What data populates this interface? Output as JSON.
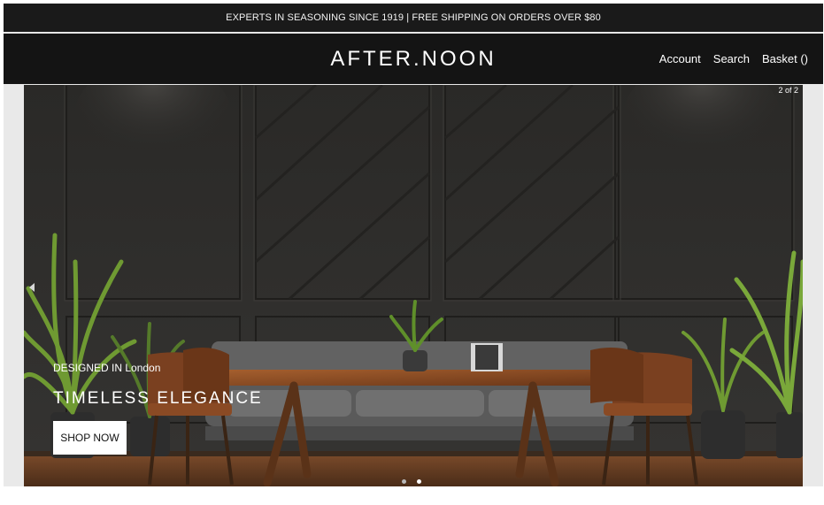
{
  "promo": {
    "text": "EXPERTS IN SEASONING SINCE 1919 | FREE SHIPPING ON ORDERS OVER $80"
  },
  "header": {
    "logo": "AFTER.NOON",
    "nav": {
      "account": "Account",
      "search": "Search",
      "basket": "Basket ()"
    }
  },
  "hero": {
    "counter": "2 of 2",
    "subtitle": "DESIGNED IN London",
    "title": "TIMELESS ELEGANCE",
    "cta": "SHOP NOW",
    "slides_total": 2,
    "active_slide": 2
  },
  "colors": {
    "header_bg": "#141414",
    "promo_bg": "#1a1a1a",
    "wall": "#2b2a28",
    "sofa": "#6b6b6b",
    "wood": "#8a4a22"
  }
}
